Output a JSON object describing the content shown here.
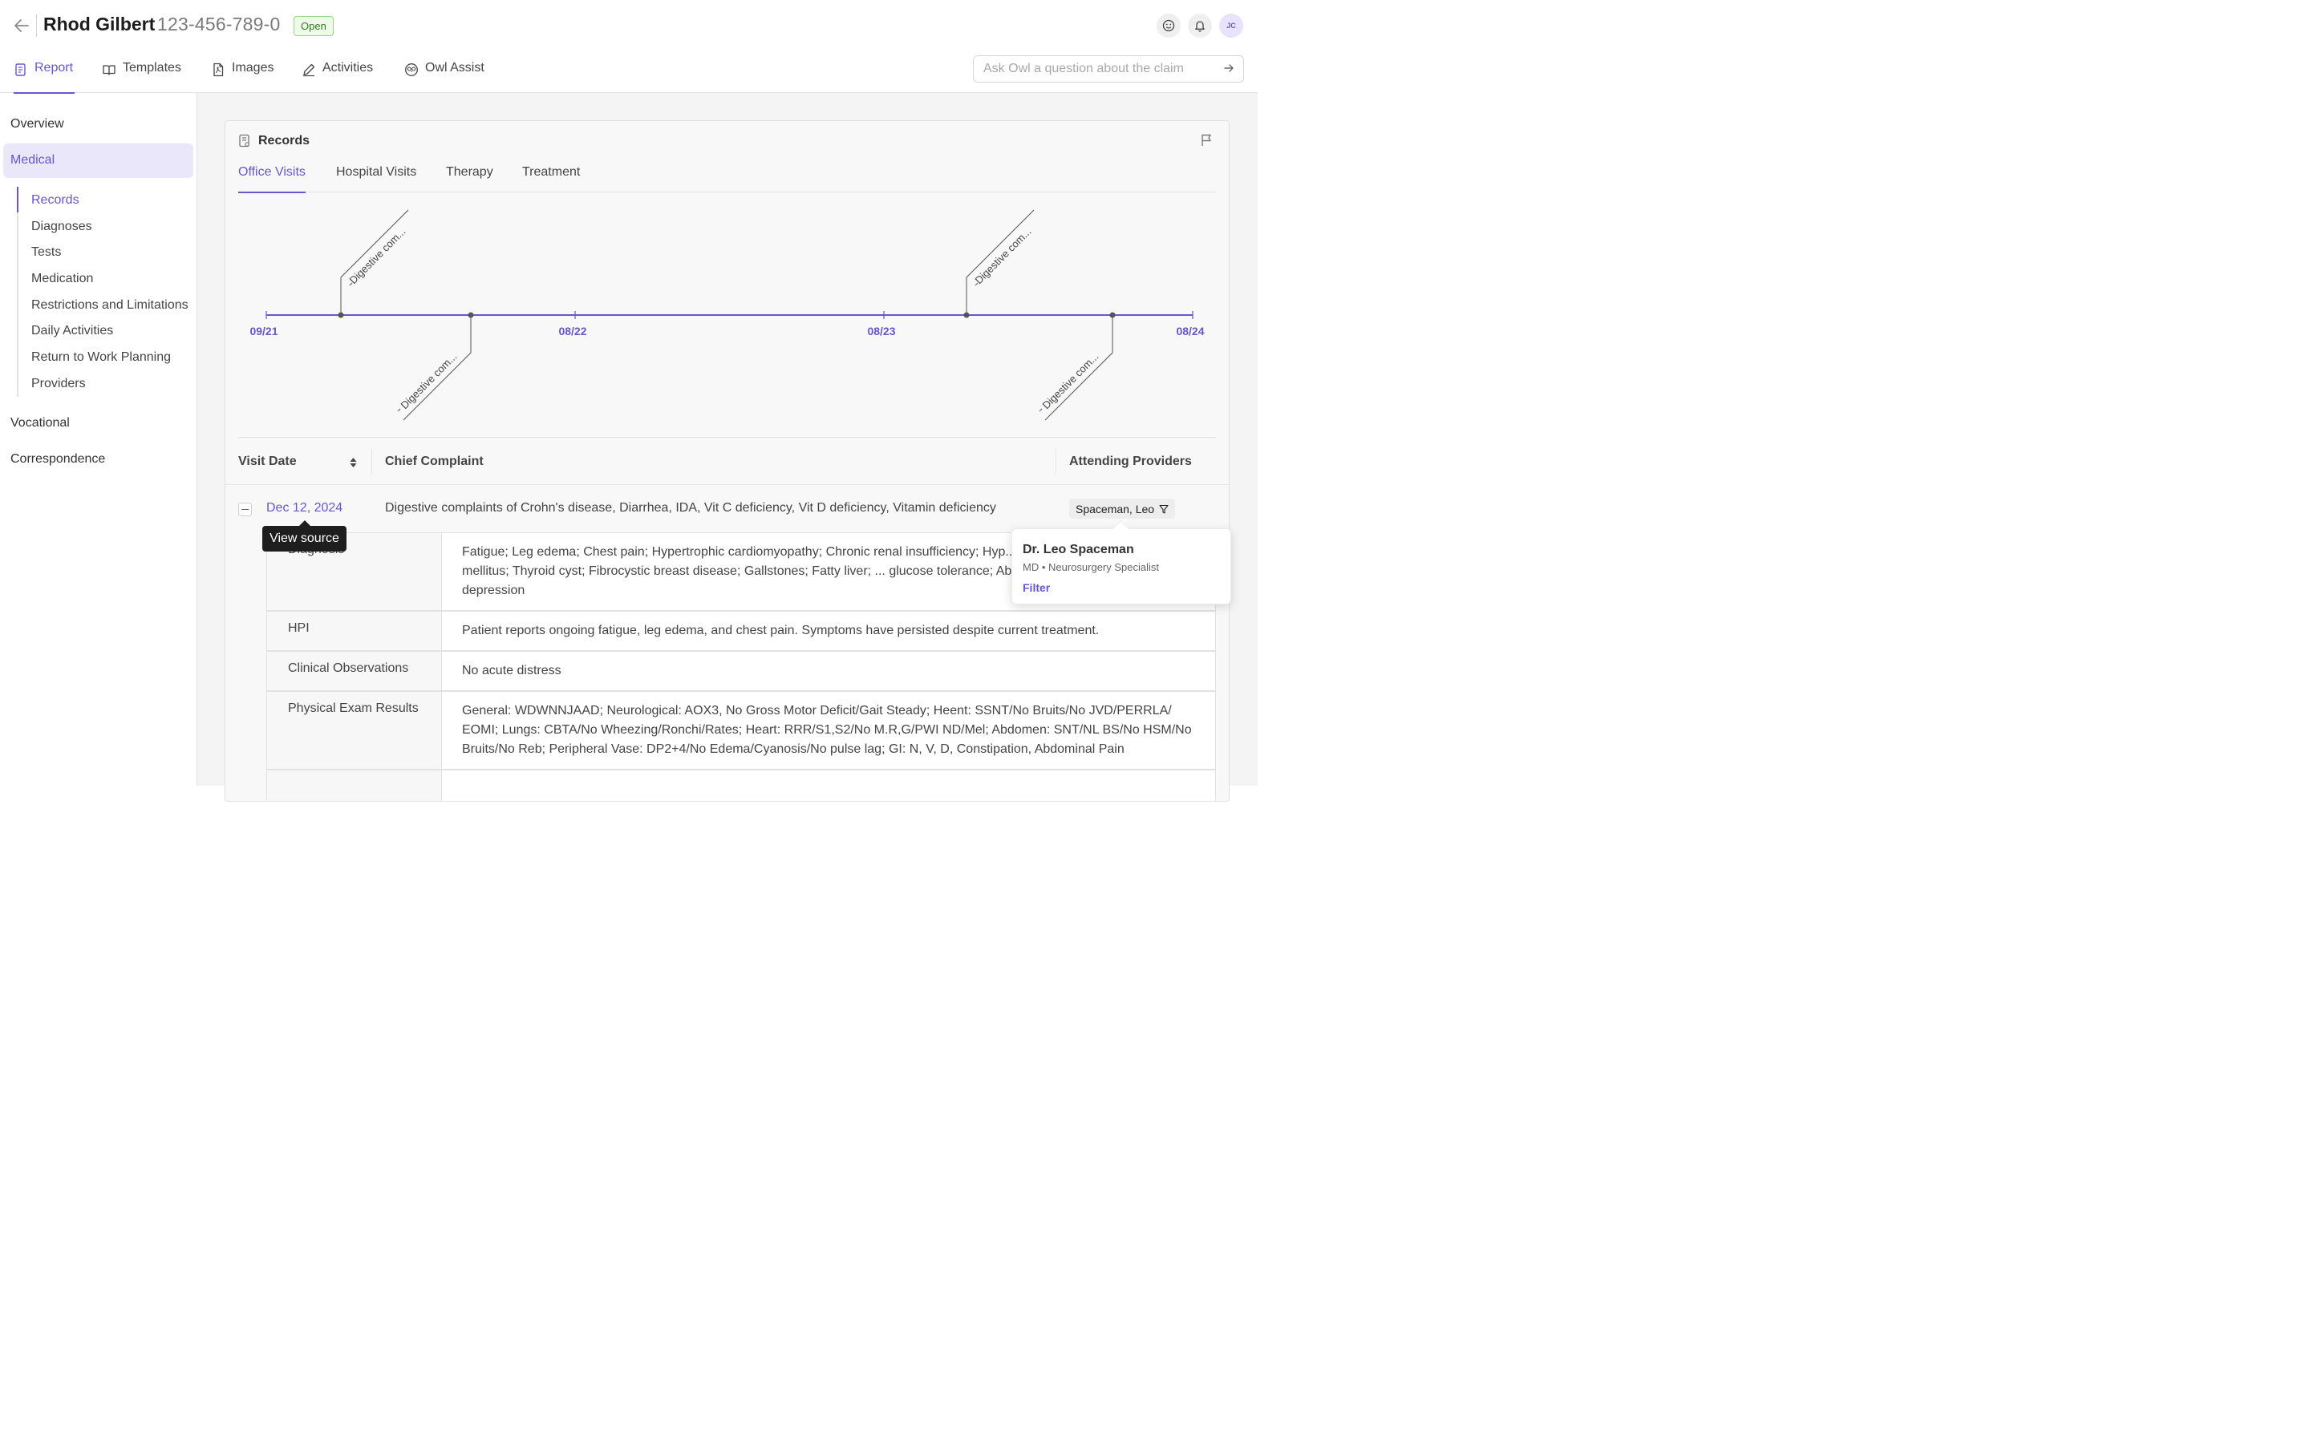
{
  "header": {
    "claimant": "Rhod Gilbert",
    "claim_number": "123-456-789-0",
    "status": "Open",
    "avatar_initials": "JC"
  },
  "tabs": [
    {
      "label": "Report",
      "icon": "report-icon"
    },
    {
      "label": "Templates",
      "icon": "book-icon"
    },
    {
      "label": "Images",
      "icon": "pdf-file-icon"
    },
    {
      "label": "Activities",
      "icon": "pencil-icon"
    },
    {
      "label": "Owl Assist",
      "icon": "owl-icon"
    }
  ],
  "ask": {
    "placeholder": "Ask Owl a question about the claim"
  },
  "sidebar": {
    "groups": [
      "Overview",
      "Medical",
      "Vocational",
      "Correspondence"
    ],
    "active_group": "Medical",
    "items": [
      "Records",
      "Diagnoses",
      "Tests",
      "Medication",
      "Restrictions and Limitations",
      "Daily Activities",
      "Return to Work Planning",
      "Providers"
    ],
    "active_item": "Records"
  },
  "records": {
    "title": "Records",
    "subtabs": [
      "Office Visits",
      "Hospital Visits",
      "Therapy",
      "Treatment"
    ],
    "active_subtab": "Office Visits",
    "timeline": {
      "axis_labels": [
        "09/21",
        "08/22",
        "08/23",
        "08/24"
      ],
      "events": [
        {
          "label": "Digestive com...",
          "side": "above"
        },
        {
          "label": "Digestive com...",
          "side": "below"
        },
        {
          "label": "Digestive com...",
          "side": "above"
        },
        {
          "label": "Digestive com...",
          "side": "below"
        }
      ]
    },
    "table": {
      "headers": {
        "visit_date": "Visit Date",
        "chief_complaint": "Chief Complaint",
        "providers": "Attending Providers"
      },
      "row": {
        "date": "Dec 12, 2024",
        "complaint": "Digestive complaints of Crohn's disease, Diarrhea, IDA, Vit C deficiency, Vit D deficiency, Vitamin deficiency",
        "provider": "Spaceman, Leo"
      },
      "details": [
        {
          "label": "Diagnosis",
          "value": "Fatigue; Leg edema; Chest pain; Hypertrophic cardiomyopathy; Chronic renal insufficiency; Hyp... Dyslipidemia; Diabetes mellitus; Thyroid cyst; Fibrocystic breast disease; Gallstones; Fatty liver; ... glucose tolerance; Abdominal pain; Anxiety and depression"
        },
        {
          "label": "HPI",
          "value": "Patient reports ongoing fatigue, leg edema, and chest pain. Symptoms have persisted despite current treatment."
        },
        {
          "label": "Clinical Observations",
          "value": "No acute distress"
        },
        {
          "label": "Physical Exam Results",
          "value": "General: WDWNNJAAD; Neurological: AOX3, No Gross Motor Deficit/Gait Steady; Heent: SSNT/No Bruits/No JVD/PERRLA/ EOMI; Lungs: CBTA/No Wheezing/Ronchi/Rates; Heart: RRR/S1,S2/No M.R,G/PWI ND/Mel; Abdomen: SNT/NL BS/No HSM/No Bruits/No Reb; Peripheral Vase: DP2+4/No Edema/Cyanosis/No pulse lag; GI: N, V, D, Constipation, Abdominal Pain"
        }
      ]
    }
  },
  "tooltip": "View source",
  "popover": {
    "name": "Dr. Leo Spaceman",
    "role": "MD • Neurosurgery Specialist",
    "action": "Filter"
  },
  "colors": {
    "accent": "#6a55d1",
    "status_bg": "#eefbe9",
    "status_text": "#2f7a20"
  }
}
